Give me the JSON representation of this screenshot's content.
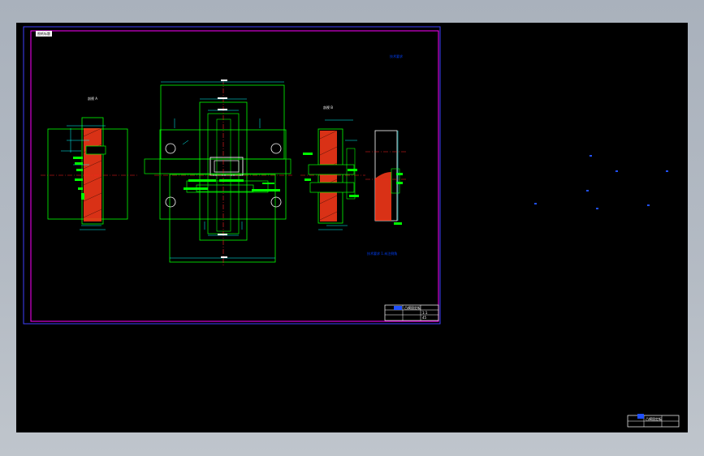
{
  "drawing": {
    "sheet_tag": "图纸标题",
    "colors": {
      "background": "#000000",
      "sheet_border": "#ff00ff",
      "frame": "#4040ff",
      "geometry": "#00ff00",
      "dimension": "#00ffff",
      "center_line": "#ff2020",
      "section_hatch": "#ff3a1a",
      "annotation": "#0040ff",
      "text": "#ffffff"
    },
    "views": [
      {
        "id": "left-section-view",
        "label": "剖视 A"
      },
      {
        "id": "plan-view",
        "label": ""
      },
      {
        "id": "right-section-view",
        "label": "剖视 B"
      },
      {
        "id": "side-view",
        "label": ""
      }
    ],
    "notes": {
      "top_right": "技术要求",
      "lower_middle": "技术要求 1.未注倒角"
    },
    "title_block": {
      "main": "凸模固定板",
      "scale": "1:1",
      "material": "45"
    },
    "secondary_title_block": {
      "main": "凸模固定板"
    }
  }
}
